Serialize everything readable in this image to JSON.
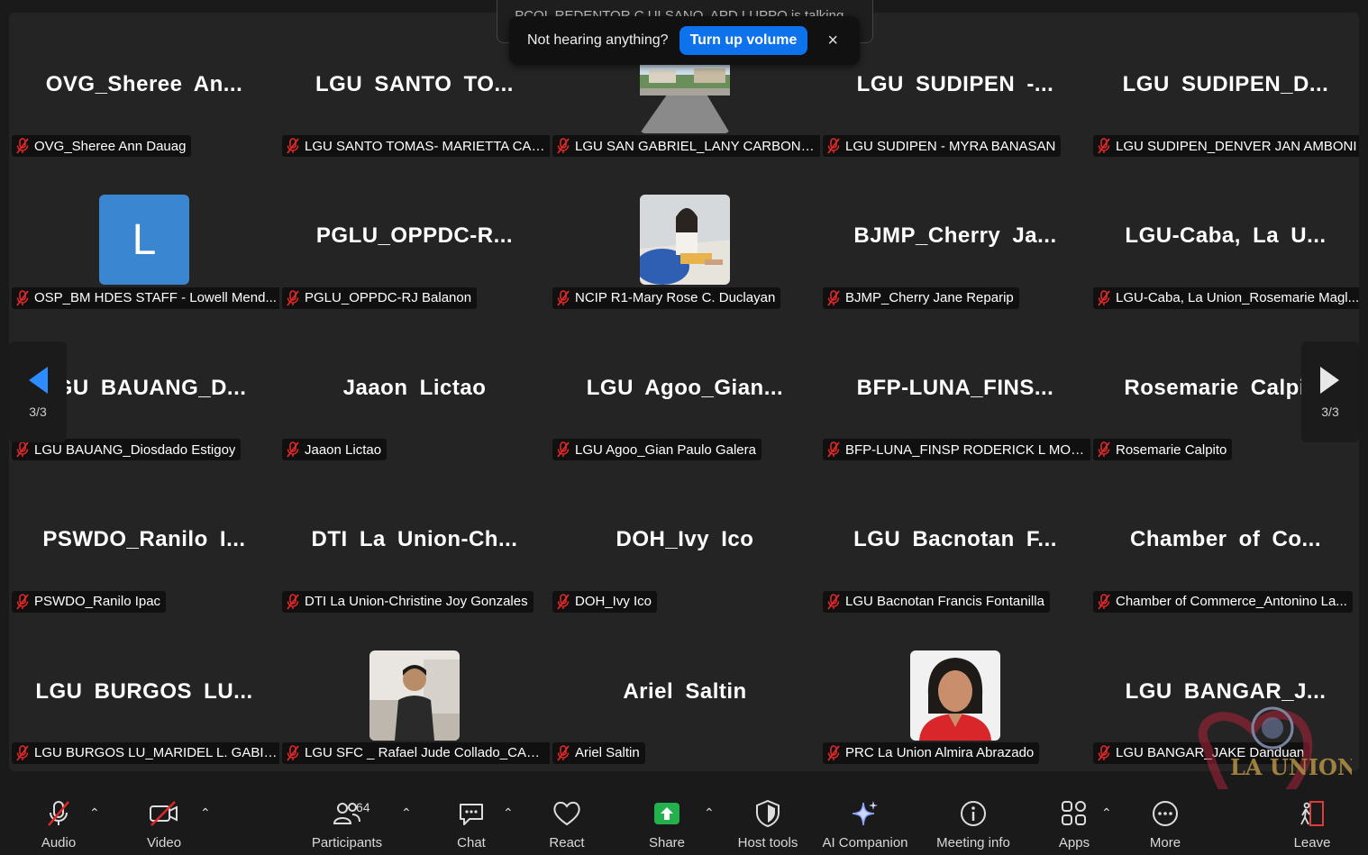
{
  "notification": {
    "talking": "PCOL REDENTOR C ULSANO, APD LUPPO is talking...",
    "message": "Not hearing anything?",
    "button": "Turn up volume",
    "close": "×"
  },
  "pager": {
    "left_count": "3/3",
    "right_count": "3/3"
  },
  "tiles": [
    {
      "display": "OVG_Sheree  An...",
      "label": "OVG_Sheree Ann Dauag",
      "type": "name"
    },
    {
      "display": "LGU  SANTO  TO...",
      "label": "LGU SANTO TOMAS- MARIETTA CAR...",
      "type": "name"
    },
    {
      "display": "",
      "label": "LGU SAN GABRIEL_LANY CARBONELL",
      "type": "photo-street"
    },
    {
      "display": "LGU  SUDIPEN  -...",
      "label": "LGU SUDIPEN - MYRA BANASAN",
      "type": "name"
    },
    {
      "display": "LGU  SUDIPEN_D...",
      "label": "LGU SUDIPEN_DENVER JAN AMBONI",
      "type": "name"
    },
    {
      "display": "L",
      "label": "OSP_BM HDES STAFF - Lowell Mend...",
      "type": "letter"
    },
    {
      "display": "PGLU_OPPDC-R...",
      "label": "PGLU_OPPDC-RJ Balanon",
      "type": "name"
    },
    {
      "display": "",
      "label": "NCIP R1-Mary Rose C. Duclayan",
      "type": "photo-woman-sitting"
    },
    {
      "display": "BJMP_Cherry  Ja...",
      "label": "BJMP_Cherry Jane Reparip",
      "type": "name"
    },
    {
      "display": "LGU-Caba,  La  U...",
      "label": "LGU-Caba, La Union_Rosemarie Magl...",
      "type": "name"
    },
    {
      "display": "LGU  BAUANG_D...",
      "label": "LGU BAUANG_Diosdado Estigoy",
      "type": "name"
    },
    {
      "display": "Jaaon Lictao",
      "label": "Jaaon Lictao",
      "type": "name"
    },
    {
      "display": "LGU  Agoo_Gian...",
      "label": "LGU Agoo_Gian Paulo Galera",
      "type": "name"
    },
    {
      "display": "BFP-LUNA_FINS...",
      "label": "BFP-LUNA_FINSP RODERICK L MOS...",
      "type": "name"
    },
    {
      "display": "Rosemarie Calpito",
      "label": "Rosemarie Calpito",
      "type": "name"
    },
    {
      "display": "PSWDO_Ranilo  I...",
      "label": "PSWDO_Ranilo Ipac",
      "type": "name"
    },
    {
      "display": "DTI  La  Union-Ch...",
      "label": "DTI La Union-Christine Joy Gonzales",
      "type": "name"
    },
    {
      "display": "DOH_Ivy Ico",
      "label": "DOH_Ivy Ico",
      "type": "name"
    },
    {
      "display": "LGU  Bacnotan  F...",
      "label": "LGU Bacnotan Francis Fontanilla",
      "type": "name"
    },
    {
      "display": "Chamber  of  Co...",
      "label": "Chamber of Commerce_Antonino La...",
      "type": "name"
    },
    {
      "display": "LGU  BURGOS  LU...",
      "label": "LGU BURGOS LU_MARIDEL L. GABINO",
      "type": "name"
    },
    {
      "display": "",
      "label": "LGU SFC _ Rafael Jude Collado_CADA...",
      "type": "photo-man"
    },
    {
      "display": "Ariel Saltin",
      "label": "Ariel Saltin",
      "type": "name"
    },
    {
      "display": "",
      "label": "PRC La Union Almira Abrazado",
      "type": "photo-woman-red"
    },
    {
      "display": "LGU  BANGAR_J...",
      "label": "LGU BANGAR_JAKE Danduan",
      "type": "name"
    }
  ],
  "toolbar": {
    "audio": "Audio",
    "video": "Video",
    "participants": "Participants",
    "participants_count": "64",
    "chat": "Chat",
    "react": "React",
    "share": "Share",
    "host_tools": "Host tools",
    "ai_companion": "AI Companion",
    "meeting_info": "Meeting info",
    "apps": "Apps",
    "more": "More",
    "leave": "Leave",
    "caret": "⌃"
  },
  "watermark": {
    "text": "LA UNION"
  },
  "colors": {
    "accent": "#0e72ed",
    "share_green": "#22b14c",
    "muted_red": "#e02828",
    "leave_red": "#e03a3a"
  }
}
